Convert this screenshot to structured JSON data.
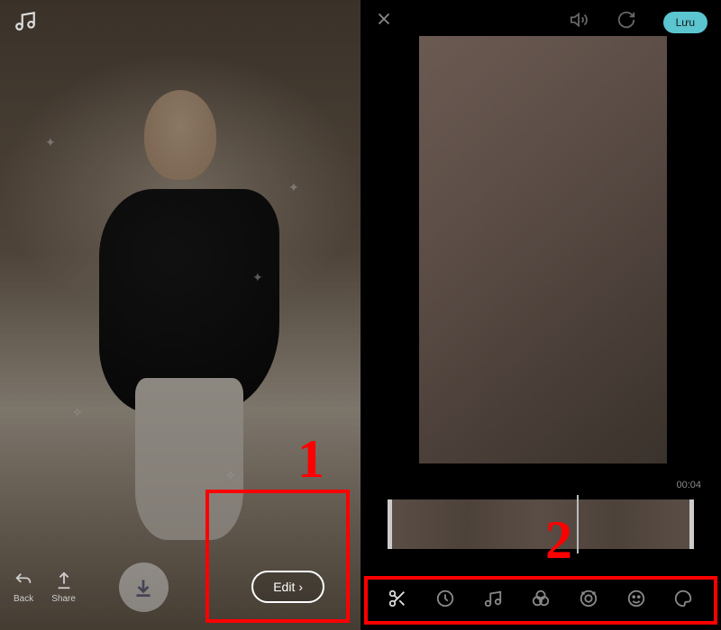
{
  "left": {
    "music_icon": "music-note",
    "back_label": "Back",
    "share_label": "Share",
    "download_icon": "download",
    "edit_label": "Edit",
    "annotation": "1"
  },
  "right": {
    "close_icon": "close",
    "volume_icon": "volume",
    "refresh_icon": "refresh",
    "save_label": "Lưu",
    "timestamp": "00:04",
    "annotation": "2",
    "tools": [
      {
        "name": "cut-icon",
        "active": true
      },
      {
        "name": "speed-icon",
        "active": false
      },
      {
        "name": "music-icon",
        "active": false
      },
      {
        "name": "filter-icon",
        "active": false
      },
      {
        "name": "beauty-icon",
        "active": false
      },
      {
        "name": "sticker-icon",
        "active": false
      },
      {
        "name": "canvas-icon",
        "active": false
      }
    ]
  },
  "colors": {
    "annotation_red": "#ff0000",
    "save_bg": "#5bc5d0"
  }
}
